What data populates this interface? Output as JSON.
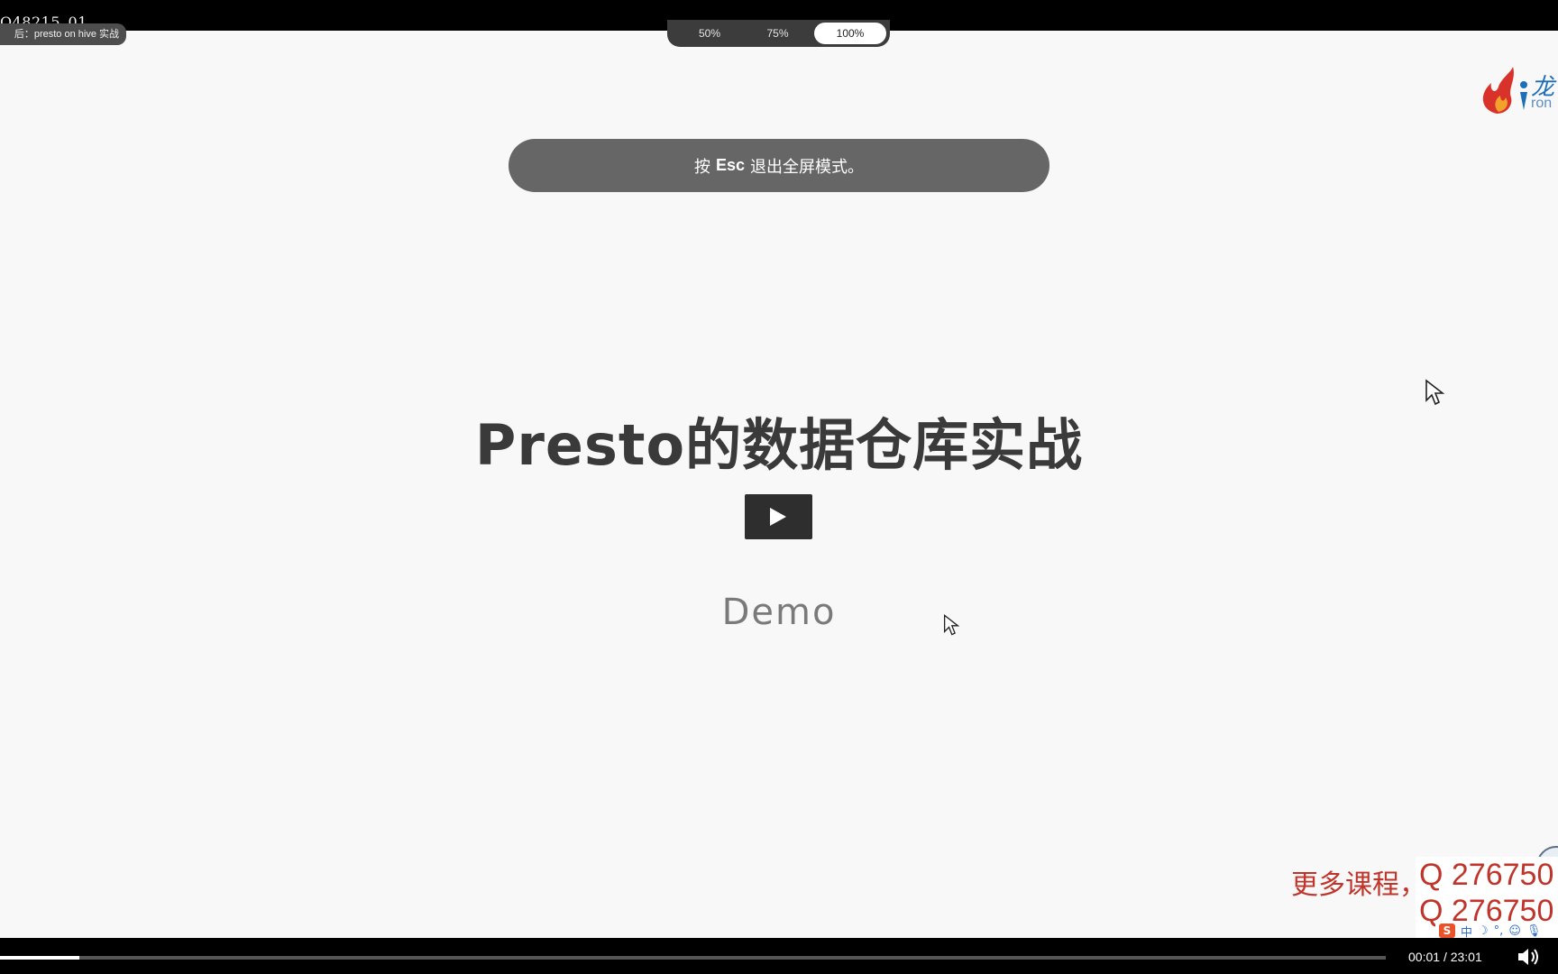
{
  "player": {
    "watermark_id": "Q48215_01",
    "video_title": "后：presto on hive 实战",
    "zoom_options": [
      "50%",
      "75%",
      "100%"
    ],
    "zoom_selected": "100%",
    "esc_notice": {
      "prefix": "按",
      "key": "Esc",
      "suffix": "退出全屏模式。"
    },
    "progress_fraction": 0.057,
    "time_current": "00:01",
    "time_separator": "/",
    "time_total": "23:01",
    "icons": {
      "play": "play-icon",
      "volume": "volume-icon",
      "cursor": "mouse-pointer-icon"
    }
  },
  "slide": {
    "title": "Presto的数据仓库实战",
    "subtitle": "Demo",
    "logo_text": "龙",
    "logo_sub": "ron"
  },
  "overlay": {
    "promo_text": "更多课程，",
    "promo_q1": "Q 276750",
    "promo_q2": "Q 276750",
    "ime_items": [
      "中",
      "☽",
      "°,",
      "☺",
      "🎙"
    ]
  },
  "colors": {
    "slide_background": "#f8f8f8",
    "toast_background": "#666666",
    "promo_red": "#c0352b",
    "logo_blue": "#1f6fb8"
  }
}
